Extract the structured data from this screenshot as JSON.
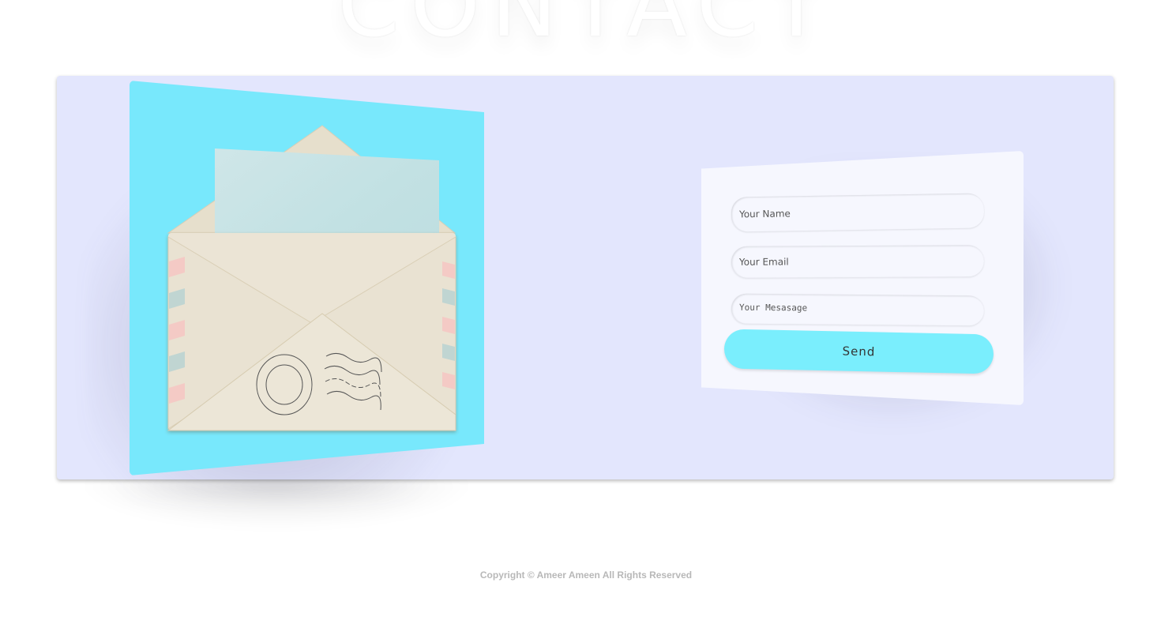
{
  "background_heading": "CONTACT",
  "contact_form": {
    "name_placeholder": "Your Name",
    "email_placeholder": "Your Email",
    "message_placeholder": "Your Mesasage",
    "send_label": "Send"
  },
  "illustration": {
    "icon": "envelope-icon"
  },
  "colors": {
    "panel_background": "#e3e6fd",
    "mail_card": "#78e8fc",
    "send_button": "#7aeefd",
    "form_card": "#f6f7fe"
  },
  "footer": {
    "copyright": "Copyright © Ameer Ameen All Rights Reserved"
  }
}
